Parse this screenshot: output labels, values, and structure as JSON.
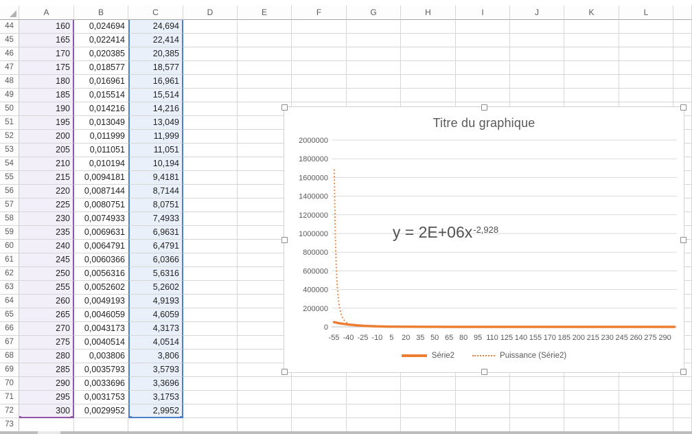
{
  "sheet": {
    "columns": [
      "A",
      "B",
      "C",
      "D",
      "E",
      "F",
      "G",
      "H",
      "I",
      "J",
      "K",
      "L"
    ],
    "rows": [
      {
        "n": "44",
        "a": "160",
        "b": "0,024694",
        "c": "24,694"
      },
      {
        "n": "45",
        "a": "165",
        "b": "0,022414",
        "c": "22,414"
      },
      {
        "n": "46",
        "a": "170",
        "b": "0,020385",
        "c": "20,385"
      },
      {
        "n": "47",
        "a": "175",
        "b": "0,018577",
        "c": "18,577"
      },
      {
        "n": "48",
        "a": "180",
        "b": "0,016961",
        "c": "16,961"
      },
      {
        "n": "49",
        "a": "185",
        "b": "0,015514",
        "c": "15,514"
      },
      {
        "n": "50",
        "a": "190",
        "b": "0,014216",
        "c": "14,216"
      },
      {
        "n": "51",
        "a": "195",
        "b": "0,013049",
        "c": "13,049"
      },
      {
        "n": "52",
        "a": "200",
        "b": "0,011999",
        "c": "11,999"
      },
      {
        "n": "53",
        "a": "205",
        "b": "0,011051",
        "c": "11,051"
      },
      {
        "n": "54",
        "a": "210",
        "b": "0,010194",
        "c": "10,194"
      },
      {
        "n": "55",
        "a": "215",
        "b": "0,0094181",
        "c": "9,4181"
      },
      {
        "n": "56",
        "a": "220",
        "b": "0,0087144",
        "c": "8,7144"
      },
      {
        "n": "57",
        "a": "225",
        "b": "0,0080751",
        "c": "8,0751"
      },
      {
        "n": "58",
        "a": "230",
        "b": "0,0074933",
        "c": "7,4933"
      },
      {
        "n": "59",
        "a": "235",
        "b": "0,0069631",
        "c": "6,9631"
      },
      {
        "n": "60",
        "a": "240",
        "b": "0,0064791",
        "c": "6,4791"
      },
      {
        "n": "61",
        "a": "245",
        "b": "0,0060366",
        "c": "6,0366"
      },
      {
        "n": "62",
        "a": "250",
        "b": "0,0056316",
        "c": "5,6316"
      },
      {
        "n": "63",
        "a": "255",
        "b": "0,0052602",
        "c": "5,2602"
      },
      {
        "n": "64",
        "a": "260",
        "b": "0,0049193",
        "c": "4,9193"
      },
      {
        "n": "65",
        "a": "265",
        "b": "0,0046059",
        "c": "4,6059"
      },
      {
        "n": "66",
        "a": "270",
        "b": "0,0043173",
        "c": "4,3173"
      },
      {
        "n": "67",
        "a": "275",
        "b": "0,0040514",
        "c": "4,0514"
      },
      {
        "n": "68",
        "a": "280",
        "b": "0,003806",
        "c": "3,806"
      },
      {
        "n": "69",
        "a": "285",
        "b": "0,0035793",
        "c": "3,5793"
      },
      {
        "n": "70",
        "a": "290",
        "b": "0,0033696",
        "c": "3,3696"
      },
      {
        "n": "71",
        "a": "295",
        "b": "0,0031753",
        "c": "3,1753"
      },
      {
        "n": "72",
        "a": "300",
        "b": "0,0029952",
        "c": "2,9952"
      },
      {
        "n": "73",
        "a": "",
        "b": "",
        "c": ""
      }
    ]
  },
  "chart": {
    "title": "Titre du graphique",
    "equation": {
      "base": "y = 2E+06x",
      "exponent": "-2,928"
    },
    "legend": [
      {
        "label": "Série2",
        "style": "solid"
      },
      {
        "label": "Puissance (Série2)",
        "style": "dotted"
      }
    ]
  },
  "chart_data": {
    "type": "line",
    "title": "Titre du graphique",
    "xlabel": "",
    "ylabel": "",
    "ylim": [
      0,
      2000000
    ],
    "grid": true,
    "legend_position": "bottom",
    "x_range": {
      "start": -55,
      "end": 300,
      "step": 5,
      "n_categories": 72
    },
    "x_tick_labels": [
      "-55",
      "-40",
      "-25",
      "-10",
      "5",
      "20",
      "35",
      "50",
      "65",
      "80",
      "95",
      "110",
      "125",
      "140",
      "155",
      "170",
      "185",
      "200",
      "215",
      "230",
      "245",
      "260",
      "275",
      "290"
    ],
    "y_ticks": [
      0,
      200000,
      400000,
      600000,
      800000,
      1000000,
      1200000,
      1400000,
      1600000,
      1800000,
      2000000
    ],
    "y_tick_labels": [
      "0",
      "200000",
      "400000",
      "600000",
      "800000",
      "1000000",
      "1200000",
      "1400000",
      "1600000",
      "1800000",
      "2000000"
    ],
    "series": [
      {
        "name": "Série2",
        "color": "#ED7D31",
        "line_style": "solid",
        "note": "values for x=160..300 are exact (column C); earlier points estimated from pixels",
        "points": [
          [
            -55,
            51000
          ],
          [
            -50,
            40000
          ],
          [
            -45,
            31500
          ],
          [
            -40,
            25000
          ],
          [
            -35,
            19700
          ],
          [
            -30,
            15400
          ],
          [
            -25,
            12000
          ],
          [
            -20,
            9300
          ],
          [
            -15,
            7200
          ],
          [
            -10,
            5500
          ],
          [
            -5,
            4200
          ],
          [
            0,
            3200
          ],
          [
            5,
            2600
          ],
          [
            20,
            1400
          ],
          [
            35,
            800
          ],
          [
            50,
            480
          ],
          [
            65,
            300
          ],
          [
            80,
            200
          ],
          [
            95,
            135
          ],
          [
            110,
            92
          ],
          [
            125,
            64
          ],
          [
            140,
            46
          ],
          [
            160,
            24.694
          ],
          [
            200,
            11.999
          ],
          [
            250,
            5.6316
          ],
          [
            300,
            2.9952
          ]
        ]
      },
      {
        "name": "Puissance (Série2)",
        "color": "#ED7D31",
        "line_style": "dotted",
        "trendline": true,
        "formula_display": "y = 2E+06x^-2,928",
        "coefficient": 2000000,
        "exponent": -2.928
      }
    ]
  },
  "colors": {
    "series_orange": "#ED7D31",
    "category_highlight_purple": "#9055A5",
    "value_highlight_blue": "#4D7EC8",
    "category_fill": "#F3EFF8",
    "value_fill": "#EAF0FA",
    "gridline": "#D6D6D6",
    "chart_gridline": "#D9D9D9",
    "chart_text": "#595959"
  }
}
